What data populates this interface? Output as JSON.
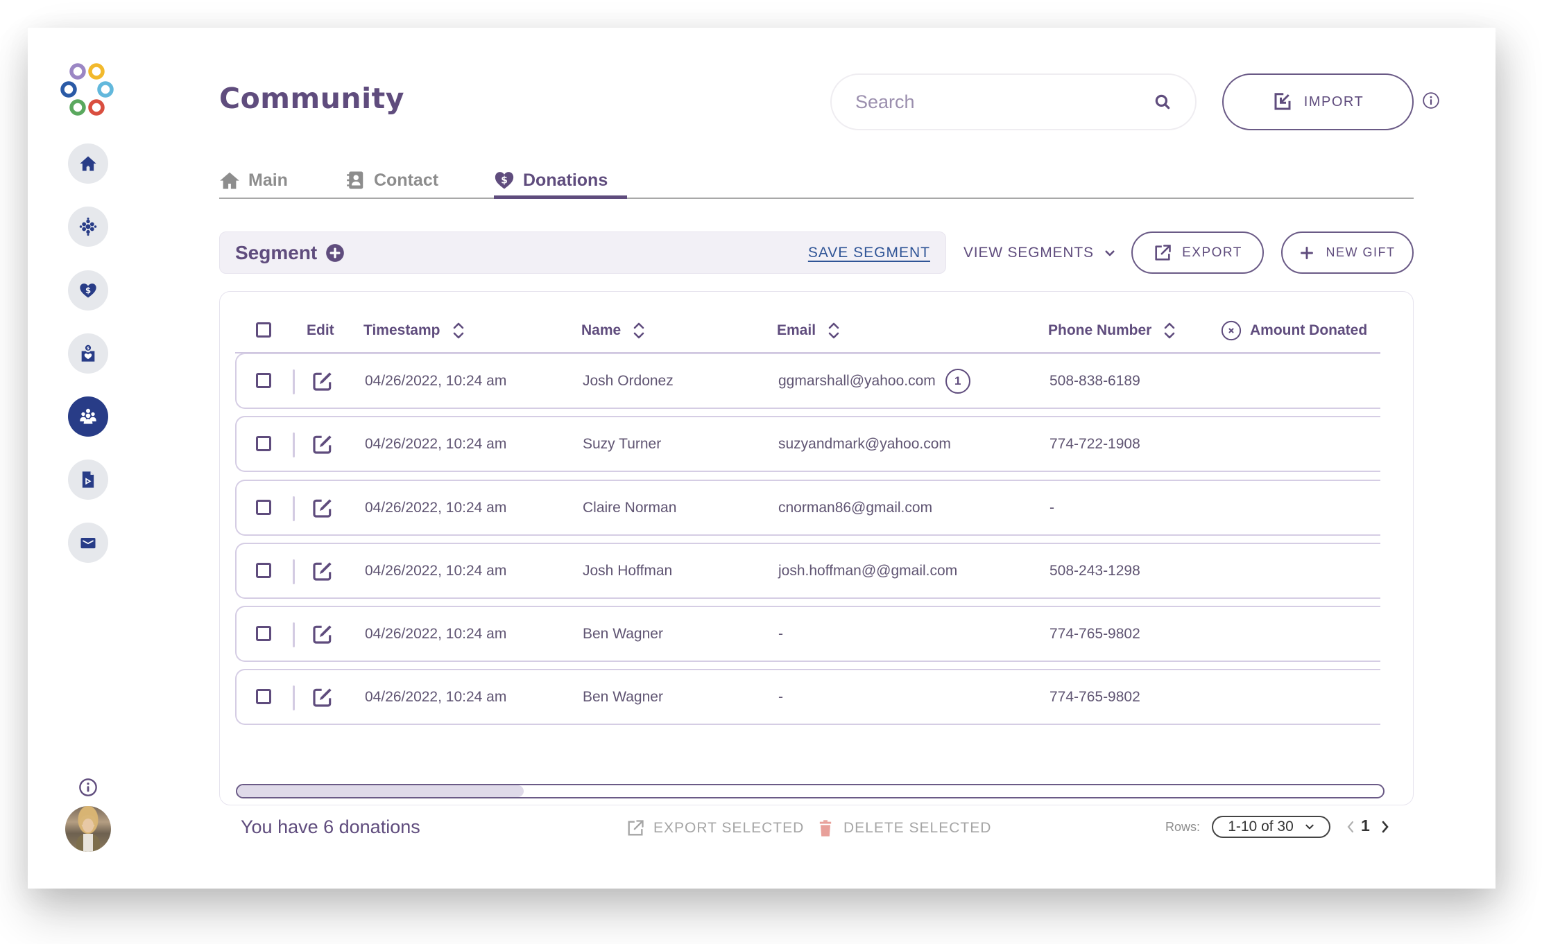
{
  "app": {
    "title": "Community",
    "logo_colors": [
      "#9b86c4",
      "#f2b92c",
      "#2a5aa6",
      "#62b8dc",
      "#5aa85e",
      "#d94e3f"
    ]
  },
  "sidebar": {
    "items": [
      {
        "name": "home",
        "icon": "home-icon",
        "active": false
      },
      {
        "name": "network",
        "icon": "network-icon",
        "active": false
      },
      {
        "name": "donations",
        "icon": "heart-dollar-icon",
        "active": false
      },
      {
        "name": "fundraising",
        "icon": "donation-box-icon",
        "active": false
      },
      {
        "name": "community",
        "icon": "people-group-icon",
        "active": true
      },
      {
        "name": "media",
        "icon": "video-file-icon",
        "active": false
      },
      {
        "name": "mail",
        "icon": "envelope-icon",
        "active": false
      }
    ],
    "bottom": {
      "info_icon": "info-icon",
      "avatar": "user-avatar"
    }
  },
  "header": {
    "search": {
      "placeholder": "Search",
      "value": ""
    },
    "import_label": "IMPORT"
  },
  "tabs": [
    {
      "label": "Main",
      "icon": "home-icon",
      "active": false
    },
    {
      "label": "Contact",
      "icon": "address-book-icon",
      "active": false
    },
    {
      "label": "Donations",
      "icon": "heart-dollar-icon",
      "active": true
    }
  ],
  "toolbar": {
    "segment_label": "Segment",
    "save_segment_label": "SAVE SEGMENT",
    "view_segments_label": "VIEW SEGMENTS",
    "export_label": "EXPORT",
    "new_gift_label": "NEW GIFT"
  },
  "table": {
    "columns": {
      "edit": "Edit",
      "timestamp": "Timestamp",
      "name": "Name",
      "email": "Email",
      "phone": "Phone Number",
      "amount": "Amount Donated"
    },
    "rows": [
      {
        "timestamp": "04/26/2022, 10:24 am",
        "name": "Josh Ordonez",
        "email": "ggmarshall@yahoo.com",
        "email_badge": "1",
        "phone": "508-838-6189",
        "amount": ""
      },
      {
        "timestamp": "04/26/2022, 10:24 am",
        "name": "Suzy Turner",
        "email": "suzyandmark@yahoo.com",
        "email_badge": null,
        "phone": "774-722-1908",
        "amount": ""
      },
      {
        "timestamp": "04/26/2022, 10:24 am",
        "name": "Claire Norman",
        "email": "cnorman86@gmail.com",
        "email_badge": null,
        "phone": "-",
        "amount": ""
      },
      {
        "timestamp": "04/26/2022, 10:24 am",
        "name": "Josh Hoffman",
        "email": "josh.hoffman@@gmail.com",
        "email_badge": null,
        "phone": "508-243-1298",
        "amount": ""
      },
      {
        "timestamp": "04/26/2022, 10:24 am",
        "name": "Ben Wagner",
        "email": "-",
        "email_badge": null,
        "phone": "774-765-9802",
        "amount": ""
      },
      {
        "timestamp": "04/26/2022, 10:24 am",
        "name": "Ben Wagner",
        "email": "-",
        "email_badge": null,
        "phone": "774-765-9802",
        "amount": ""
      }
    ],
    "horizontal_scroll_fraction": 0.25
  },
  "footer": {
    "count_text": "You have 6 donations",
    "export_selected_label": "EXPORT SELECTED",
    "delete_selected_label": "DELETE SELECTED",
    "rows_label": "Rows:",
    "rows_select_value": "1-10 of 30",
    "current_page": "1"
  },
  "colors": {
    "primary": "#5f4c7d",
    "sidebar_active": "#283c87",
    "link": "#2f5496",
    "delete": "#e8a09a"
  }
}
